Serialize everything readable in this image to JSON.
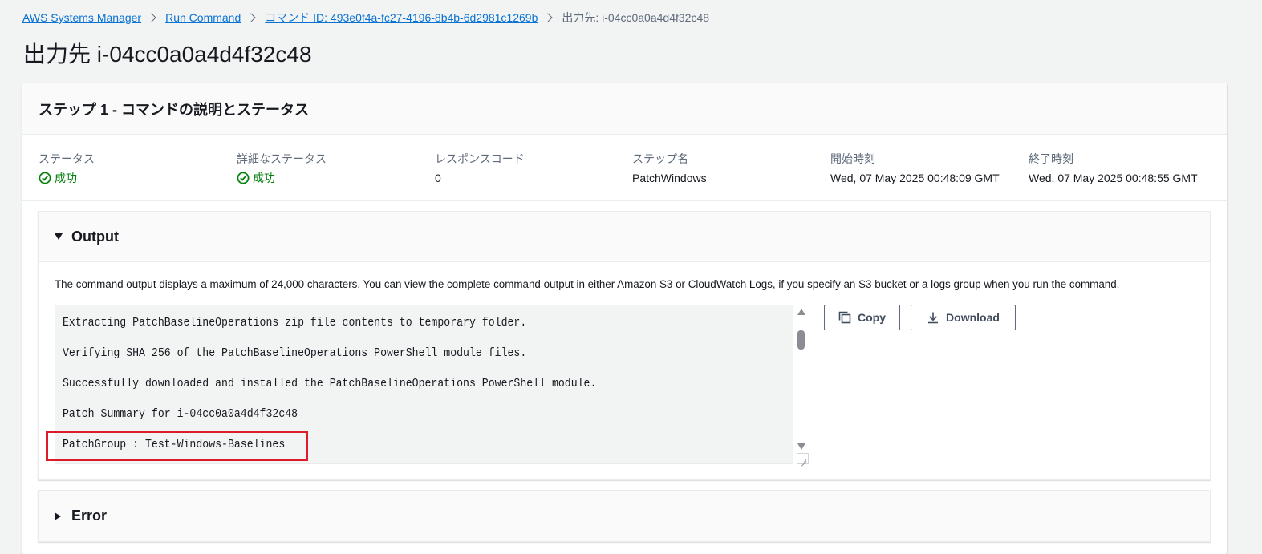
{
  "breadcrumb": {
    "items": [
      "AWS Systems Manager",
      "Run Command",
      "コマンド ID: 493e0f4a-fc27-4196-8b4b-6d2981c1269b"
    ],
    "current": "出力先: i-04cc0a0a4d4f32c48"
  },
  "page_title": "出力先 i-04cc0a0a4d4f32c48",
  "step_panel": {
    "title": "ステップ 1 - コマンドの説明とステータス",
    "fields": [
      {
        "key": "ステータス",
        "value": "成功",
        "status": "success"
      },
      {
        "key": "詳細なステータス",
        "value": "成功",
        "status": "success"
      },
      {
        "key": "レスポンスコード",
        "value": "0"
      },
      {
        "key": "ステップ名",
        "value": "PatchWindows"
      },
      {
        "key": "開始時刻",
        "value": "Wed, 07 May 2025 00:48:09 GMT"
      },
      {
        "key": "終了時刻",
        "value": "Wed, 07 May 2025 00:48:55 GMT"
      }
    ]
  },
  "output": {
    "title": "Output",
    "description": "The command output displays a maximum of 24,000 characters. You can view the complete command output in either Amazon S3 or CloudWatch Logs, if you specify an S3 bucket or a logs group when you run the command.",
    "lines": [
      "Extracting PatchBaselineOperations zip file contents to temporary folder.",
      "Verifying SHA 256 of the PatchBaselineOperations PowerShell module files.",
      "Successfully downloaded and installed the PatchBaselineOperations PowerShell module.",
      "Patch Summary for i-04cc0a0a4d4f32c48",
      "PatchGroup : Test-Windows-Baselines"
    ],
    "copy_label": "Copy",
    "download_label": "Download"
  },
  "error": {
    "title": "Error"
  },
  "colors": {
    "link": "#0972d3",
    "success": "#037f0c",
    "highlight": "#dd1c2a"
  }
}
